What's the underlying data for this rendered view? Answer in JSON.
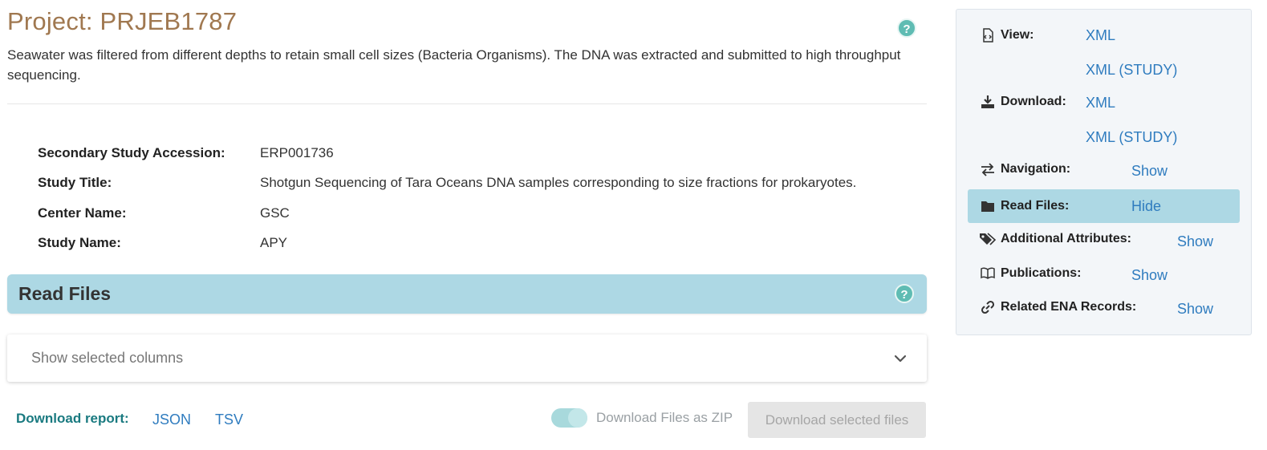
{
  "project": {
    "title": "Project: PRJEB1787",
    "description": "Seawater was filtered from different depths to retain small cell sizes (Bacteria Organisms). The DNA was extracted and submitted to high throughput sequencing.",
    "help_icon": "?"
  },
  "details": [
    {
      "label": "Secondary Study Accession:",
      "value": "ERP001736"
    },
    {
      "label": "Study Title:",
      "value": "Shotgun Sequencing of Tara Oceans DNA samples corresponding to size fractions for prokaryotes."
    },
    {
      "label": "Center Name:",
      "value": "GSC"
    },
    {
      "label": "Study Name:",
      "value": "APY"
    }
  ],
  "read_files": {
    "title": "Read Files",
    "show_columns": "Show selected columns",
    "download_report_label": "Download report:",
    "json_link": "JSON",
    "tsv_link": "TSV",
    "zip_toggle_label": "Download Files as ZIP",
    "zip_toggle_on": true,
    "download_button": "Download selected files"
  },
  "sidebar": {
    "view": {
      "label": "View:",
      "link1": "XML",
      "link2": "XML (STUDY)",
      "icon": "file-code-icon"
    },
    "download": {
      "label": "Download:",
      "link1": "XML",
      "link2": "XML (STUDY)",
      "icon": "download-icon"
    },
    "navigation": {
      "label": "Navigation:",
      "action": "Show",
      "icon": "exchange-icon"
    },
    "read_files": {
      "label": "Read Files:",
      "action": "Hide",
      "icon": "folder-icon"
    },
    "additional_attributes": {
      "label": "Additional Attributes:",
      "action": "Show",
      "icon": "tags-icon"
    },
    "publications": {
      "label": "Publications:",
      "action": "Show",
      "icon": "book-icon"
    },
    "related_records": {
      "label": "Related ENA Records:",
      "action": "Show",
      "icon": "link-icon"
    }
  },
  "colors": {
    "title": "#a07850",
    "accent": "#add8e4",
    "link": "#2f7cbf",
    "report_label": "#1a7a80"
  }
}
